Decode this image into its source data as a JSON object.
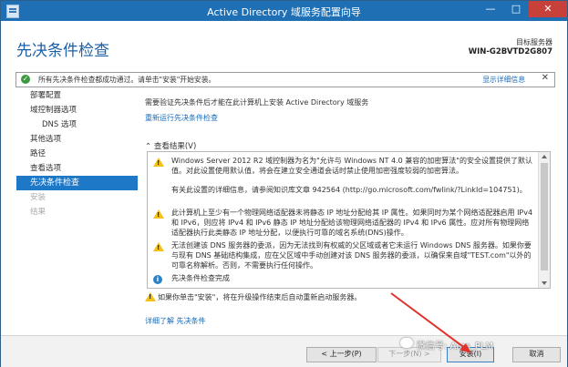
{
  "window": {
    "title": "Active Directory 域服务配置向导",
    "minimize": "—",
    "maximize": "□",
    "close": "✕"
  },
  "header": {
    "page_title": "先决条件检查",
    "target_label": "目标服务器",
    "target_server": "WIN-G2BVTD2G807"
  },
  "notice": {
    "text": "所有先决条件检查都成功通过。请单击\"安装\"开始安装。",
    "link": "显示详细信息",
    "close": "✕",
    "status_color": "#3c9a3e"
  },
  "nav": {
    "items": [
      {
        "label": "部署配置",
        "state": "normal",
        "indent": false
      },
      {
        "label": "域控制器选项",
        "state": "normal",
        "indent": false
      },
      {
        "label": "DNS 选项",
        "state": "normal",
        "indent": true
      },
      {
        "label": "其他选项",
        "state": "normal",
        "indent": false
      },
      {
        "label": "路径",
        "state": "normal",
        "indent": false
      },
      {
        "label": "查看选项",
        "state": "normal",
        "indent": false
      },
      {
        "label": "先决条件检查",
        "state": "active",
        "indent": false
      },
      {
        "label": "安装",
        "state": "disabled",
        "indent": false
      },
      {
        "label": "结果",
        "state": "disabled",
        "indent": false
      }
    ]
  },
  "content": {
    "intro": "需要验证先决条件后才能在此计算机上安装 Active Directory 域服务",
    "rerun_link": "重新运行先决条件检查",
    "results_toggle": "查看结果(V)",
    "results": [
      {
        "type": "warning",
        "text": "Windows Server 2012 R2 域控制器为名为\"允许与 Windows NT 4.0 兼容的加密算法\"的安全设置提供了默认值。对此设置使用默认值，将会在建立安全通道会话时禁止使用加密强度较弱的加密算法。\n\n有关此设置的详细信息，请参阅知识库文章 942564 (http://go.microsoft.com/fwlink/?LinkId=104751)。"
      },
      {
        "type": "warning",
        "text": "此计算机上至少有一个物理网络适配器未将静态 IP 地址分配给其 IP 属性。如果同时为某个网络适配器启用 IPv4 和 IPv6，则应将 IPv4 和 IPv6 静态 IP 地址分配给该物理网络适配器的 IPv4 和 IPv6 属性。应对所有物理网络适配器执行此类静态 IP 地址分配，以便执行可靠的域名系统(DNS)操作。"
      },
      {
        "type": "warning",
        "text": "无法创建该 DNS 服务器的委派，因为无法找到有权威的父区域或者它未运行 Windows DNS 服务器。如果你要与现有 DNS 基础结构集成，应在父区域中手动创建对该 DNS 服务器的委派，以确保来自域\"TEST.com\"以外的可靠名称解析。否则，不需要执行任何操作。"
      },
      {
        "type": "info",
        "text": "先决条件检查完成"
      }
    ],
    "bottom_warning": "如果你单击\"安装\"，将在升级操作结束后自动重新启动服务器。",
    "more_link": "详细了解 先决条件"
  },
  "footer": {
    "prev": "< 上一步(P)",
    "next": "下一步(N) >",
    "install": "安装(I)",
    "cancel": "取消"
  },
  "watermark": "微信号: Aras_PLM"
}
